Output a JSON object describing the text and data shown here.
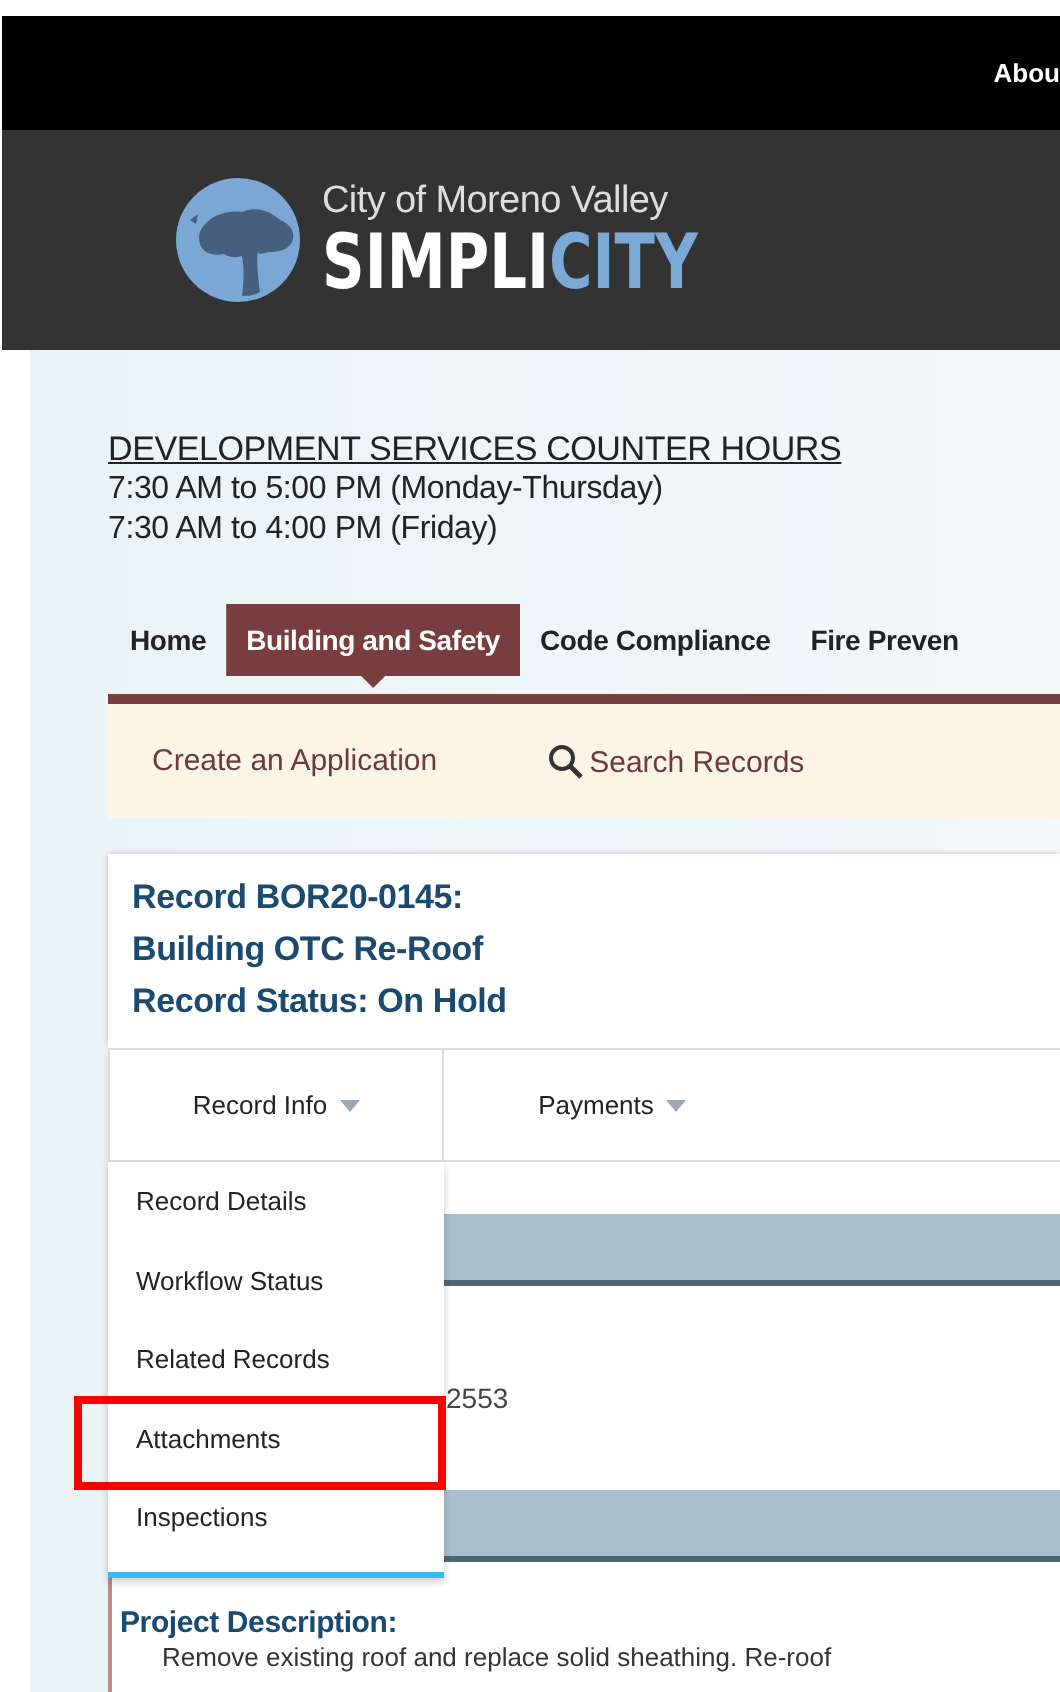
{
  "top_bar": {
    "link": "Abou"
  },
  "logo": {
    "city": "City of Moreno Valley",
    "brand_first": "SIMPLI",
    "brand_second": "CITY"
  },
  "hours": {
    "title": "DEVELOPMENT SERVICES COUNTER HOURS",
    "lines": [
      "7:30 AM to 5:00 PM (Monday-Thursday)",
      "7:30 AM to 4:00 PM (Friday)"
    ]
  },
  "nav": [
    {
      "label": "Home",
      "selected": false
    },
    {
      "label": "Building and Safety",
      "selected": true
    },
    {
      "label": "Code Compliance",
      "selected": false
    },
    {
      "label": "Fire Preven",
      "selected": false
    }
  ],
  "sub_nav": [
    {
      "label": "Create an Application",
      "kind": "link"
    },
    {
      "label": "Search Records",
      "kind": "search"
    }
  ],
  "record": {
    "lines": [
      "Record BOR20-0145:",
      "Building OTC Re-Roof",
      "Record Status: On Hold"
    ]
  },
  "record_tabs": [
    {
      "label": "Record Info",
      "expanded": true
    },
    {
      "label": "Payments",
      "expanded": false
    }
  ],
  "menu": [
    {
      "label": "Record Details",
      "highlighted": false
    },
    {
      "label": "Workflow Status",
      "highlighted": false
    },
    {
      "label": "Related Records",
      "highlighted": false
    },
    {
      "label": "Attachments",
      "highlighted": true
    },
    {
      "label": "Inspections",
      "highlighted": false
    }
  ],
  "partial_value": "2553",
  "project": {
    "heading": "Project Description:",
    "text": "Remove existing roof and replace solid sheathing. Re-roof"
  }
}
